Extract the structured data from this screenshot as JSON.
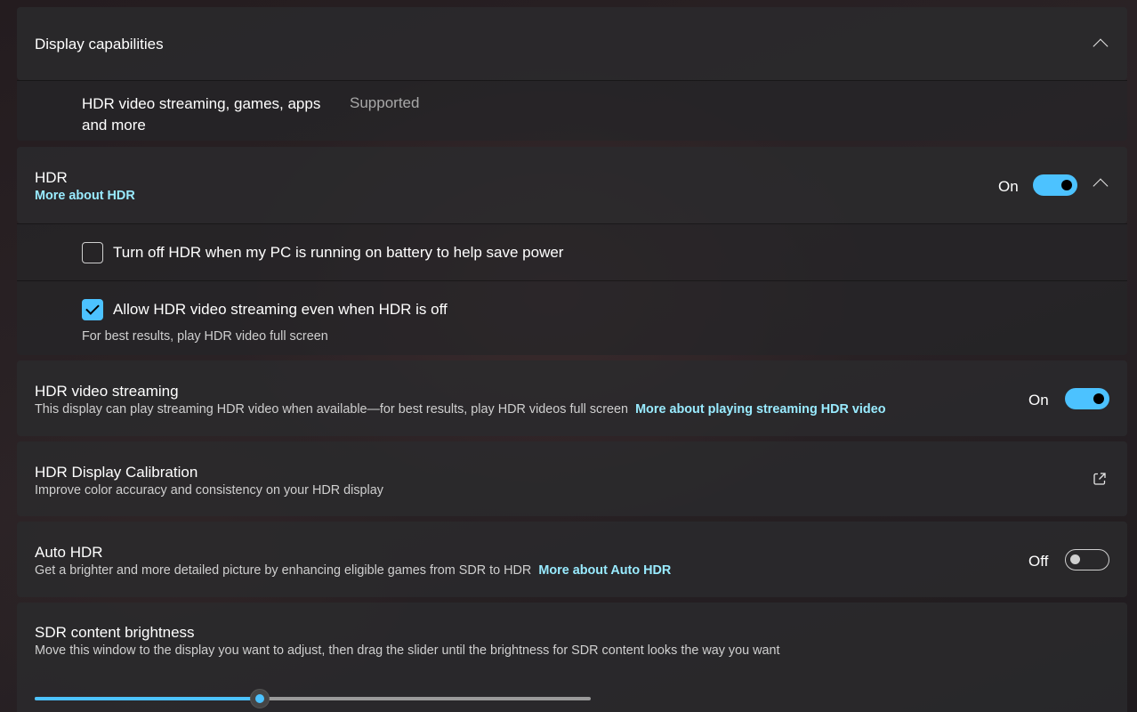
{
  "display_capabilities": {
    "title": "Display capabilities",
    "row_label_line1": "HDR video streaming, games, apps",
    "row_label_line2": "and more",
    "row_value": "Supported"
  },
  "hdr": {
    "title": "HDR",
    "link": "More about HDR",
    "state": "On",
    "enabled": true,
    "battery_option": {
      "label": "Turn off HDR when my PC is running on battery to help save power",
      "checked": false
    },
    "streaming_option": {
      "label": "Allow HDR video streaming even when HDR is off",
      "hint": "For best results, play HDR video full screen",
      "checked": true
    }
  },
  "hdr_video_streaming": {
    "title": "HDR video streaming",
    "description": "This display can play streaming HDR video when available—for best results, play HDR videos full screen",
    "link": "More about playing streaming HDR video",
    "state": "On",
    "enabled": true
  },
  "hdr_calibration": {
    "title": "HDR Display Calibration",
    "description": "Improve color accuracy and consistency on your HDR display",
    "icon": "open-external-icon"
  },
  "auto_hdr": {
    "title": "Auto HDR",
    "description": "Get a brighter and more detailed picture by enhancing eligible games from SDR to HDR",
    "link": "More about Auto HDR",
    "state": "Off",
    "enabled": false
  },
  "sdr_brightness": {
    "title": "SDR content brightness",
    "description": "Move this window to the display you want to adjust, then drag the slider until the brightness for SDR content looks the way you want",
    "slider_value_fraction": 0.405
  },
  "colors": {
    "accent": "#4cc2ff",
    "link": "#99ebff"
  }
}
